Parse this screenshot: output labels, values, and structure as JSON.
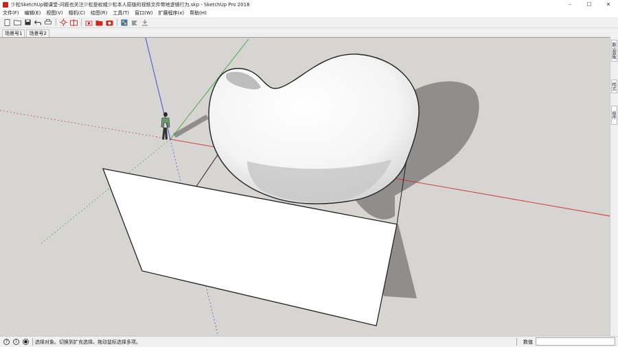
{
  "window": {
    "title": "少松SketchUp微课堂-问题也关注少松是权威少松本人原版的视频文件带地逻辑行为.skp - SketchUp Pro 2018",
    "controls": [
      "–",
      "☐",
      "✕"
    ]
  },
  "menu": [
    "文件(F)",
    "编辑(E)",
    "视图(V)",
    "相机(C)",
    "绘图(R)",
    "工具(T)",
    "窗口(W)",
    "扩展程序(x)",
    "帮助(H)"
  ],
  "scenes": [
    "场景号1",
    "场景号2"
  ],
  "right_tray": [
    "默认面板",
    "样式",
    "组件"
  ],
  "status": {
    "message": "选择对象。切换到扩充选择。拖动鼠标选择多项。",
    "measure_label": "数值",
    "measure_value": ""
  },
  "colors": {
    "axis_red": "#d22a2a",
    "axis_green": "#3aa43a",
    "axis_blue": "#3a3ad0",
    "ground": "#d6d5d2",
    "shadow": "#8f8e8c"
  }
}
